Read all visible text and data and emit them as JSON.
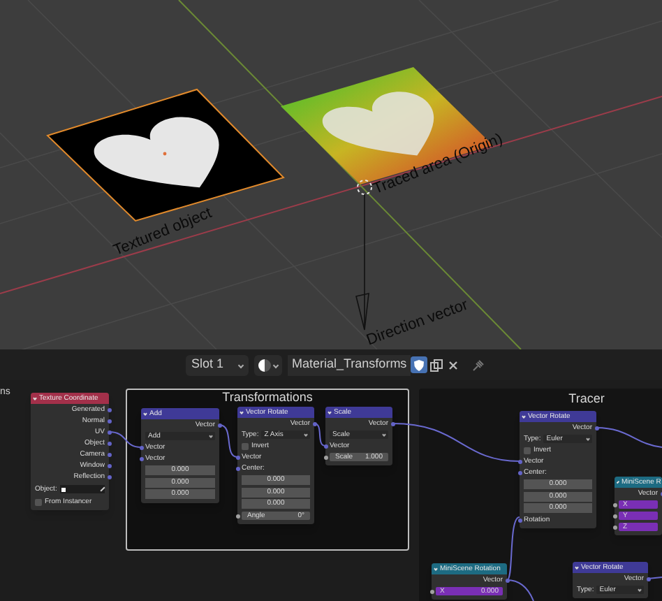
{
  "viewport": {
    "labels": [
      "Textured object",
      "Traced area (Origin)",
      "Direction vector"
    ]
  },
  "header": {
    "slot": "Slot 1",
    "material": "Material_Transforms",
    "fake_user": true
  },
  "node_editor": {
    "cut_label": "ns",
    "frames": [
      {
        "title": "Transformations"
      },
      {
        "title": "Tracer"
      }
    ],
    "nodes": [
      {
        "title": "Texture Coordinate",
        "color": "#a3304a",
        "rows": [
          {
            "kind": "output",
            "label": "Generated"
          },
          {
            "kind": "output",
            "label": "Normal"
          },
          {
            "kind": "output",
            "label": "UV"
          },
          {
            "kind": "output",
            "label": "Object"
          },
          {
            "kind": "output",
            "label": "Camera"
          },
          {
            "kind": "output",
            "label": "Window"
          },
          {
            "kind": "output",
            "label": "Reflection"
          },
          {
            "kind": "object",
            "label": "Object:"
          },
          {
            "kind": "checkbox",
            "label": "From Instancer",
            "checked": false
          }
        ]
      },
      {
        "title": "Add",
        "color": "#3f3a97",
        "rows": [
          {
            "kind": "output",
            "label": "Vector"
          },
          {
            "kind": "dropdown",
            "label": "Add"
          },
          {
            "kind": "input",
            "label": "Vector"
          },
          {
            "kind": "input",
            "label": "Vector"
          },
          {
            "kind": "number",
            "value": "0.000"
          },
          {
            "kind": "number",
            "value": "0.000"
          },
          {
            "kind": "number",
            "value": "0.000"
          }
        ]
      },
      {
        "title": "Vector Rotate",
        "color": "#3f3a97",
        "rows": [
          {
            "kind": "output",
            "label": "Vector"
          },
          {
            "kind": "type",
            "label": "Type:",
            "value": "Z Axis"
          },
          {
            "kind": "checkbox",
            "label": "Invert",
            "checked": false
          },
          {
            "kind": "input",
            "label": "Vector"
          },
          {
            "kind": "input",
            "label": "Center:"
          },
          {
            "kind": "number",
            "value": "0.000"
          },
          {
            "kind": "number",
            "value": "0.000"
          },
          {
            "kind": "number",
            "value": "0.000"
          },
          {
            "kind": "field",
            "label": "Angle",
            "value": "0°"
          }
        ]
      },
      {
        "title": "Scale",
        "color": "#3f3a97",
        "rows": [
          {
            "kind": "output",
            "label": "Vector"
          },
          {
            "kind": "dropdown",
            "label": "Scale"
          },
          {
            "kind": "input",
            "label": "Vector"
          },
          {
            "kind": "field",
            "label": "Scale",
            "value": "1.000"
          }
        ]
      },
      {
        "title": "Vector Rotate",
        "color": "#3f3a97",
        "rows": [
          {
            "kind": "output",
            "label": "Vector"
          },
          {
            "kind": "type",
            "label": "Type:",
            "value": "Euler"
          },
          {
            "kind": "checkbox",
            "label": "Invert",
            "checked": false
          },
          {
            "kind": "input",
            "label": "Vector"
          },
          {
            "kind": "input",
            "label": "Center:"
          },
          {
            "kind": "number",
            "value": "0.000"
          },
          {
            "kind": "number",
            "value": "0.000"
          },
          {
            "kind": "number",
            "value": "0.000"
          },
          {
            "kind": "input",
            "label": "Rotation"
          }
        ]
      },
      {
        "title": "MiniScene R",
        "color": "#1d6b82",
        "rows": [
          {
            "kind": "output",
            "label": "Vector"
          },
          {
            "kind": "axis",
            "label": "X"
          },
          {
            "kind": "axis",
            "label": "Y"
          },
          {
            "kind": "axis",
            "label": "Z"
          }
        ]
      },
      {
        "title": "MiniScene Rotation",
        "color": "#1d6b82",
        "rows": [
          {
            "kind": "output",
            "label": "Vector"
          },
          {
            "kind": "axis",
            "label": "X",
            "value": "0.000"
          }
        ]
      },
      {
        "title": "Vector Rotate",
        "color": "#3f3a97",
        "rows": [
          {
            "kind": "output",
            "label": "Vector"
          },
          {
            "kind": "type",
            "label": "Type:",
            "value": "Euler"
          }
        ]
      }
    ]
  }
}
